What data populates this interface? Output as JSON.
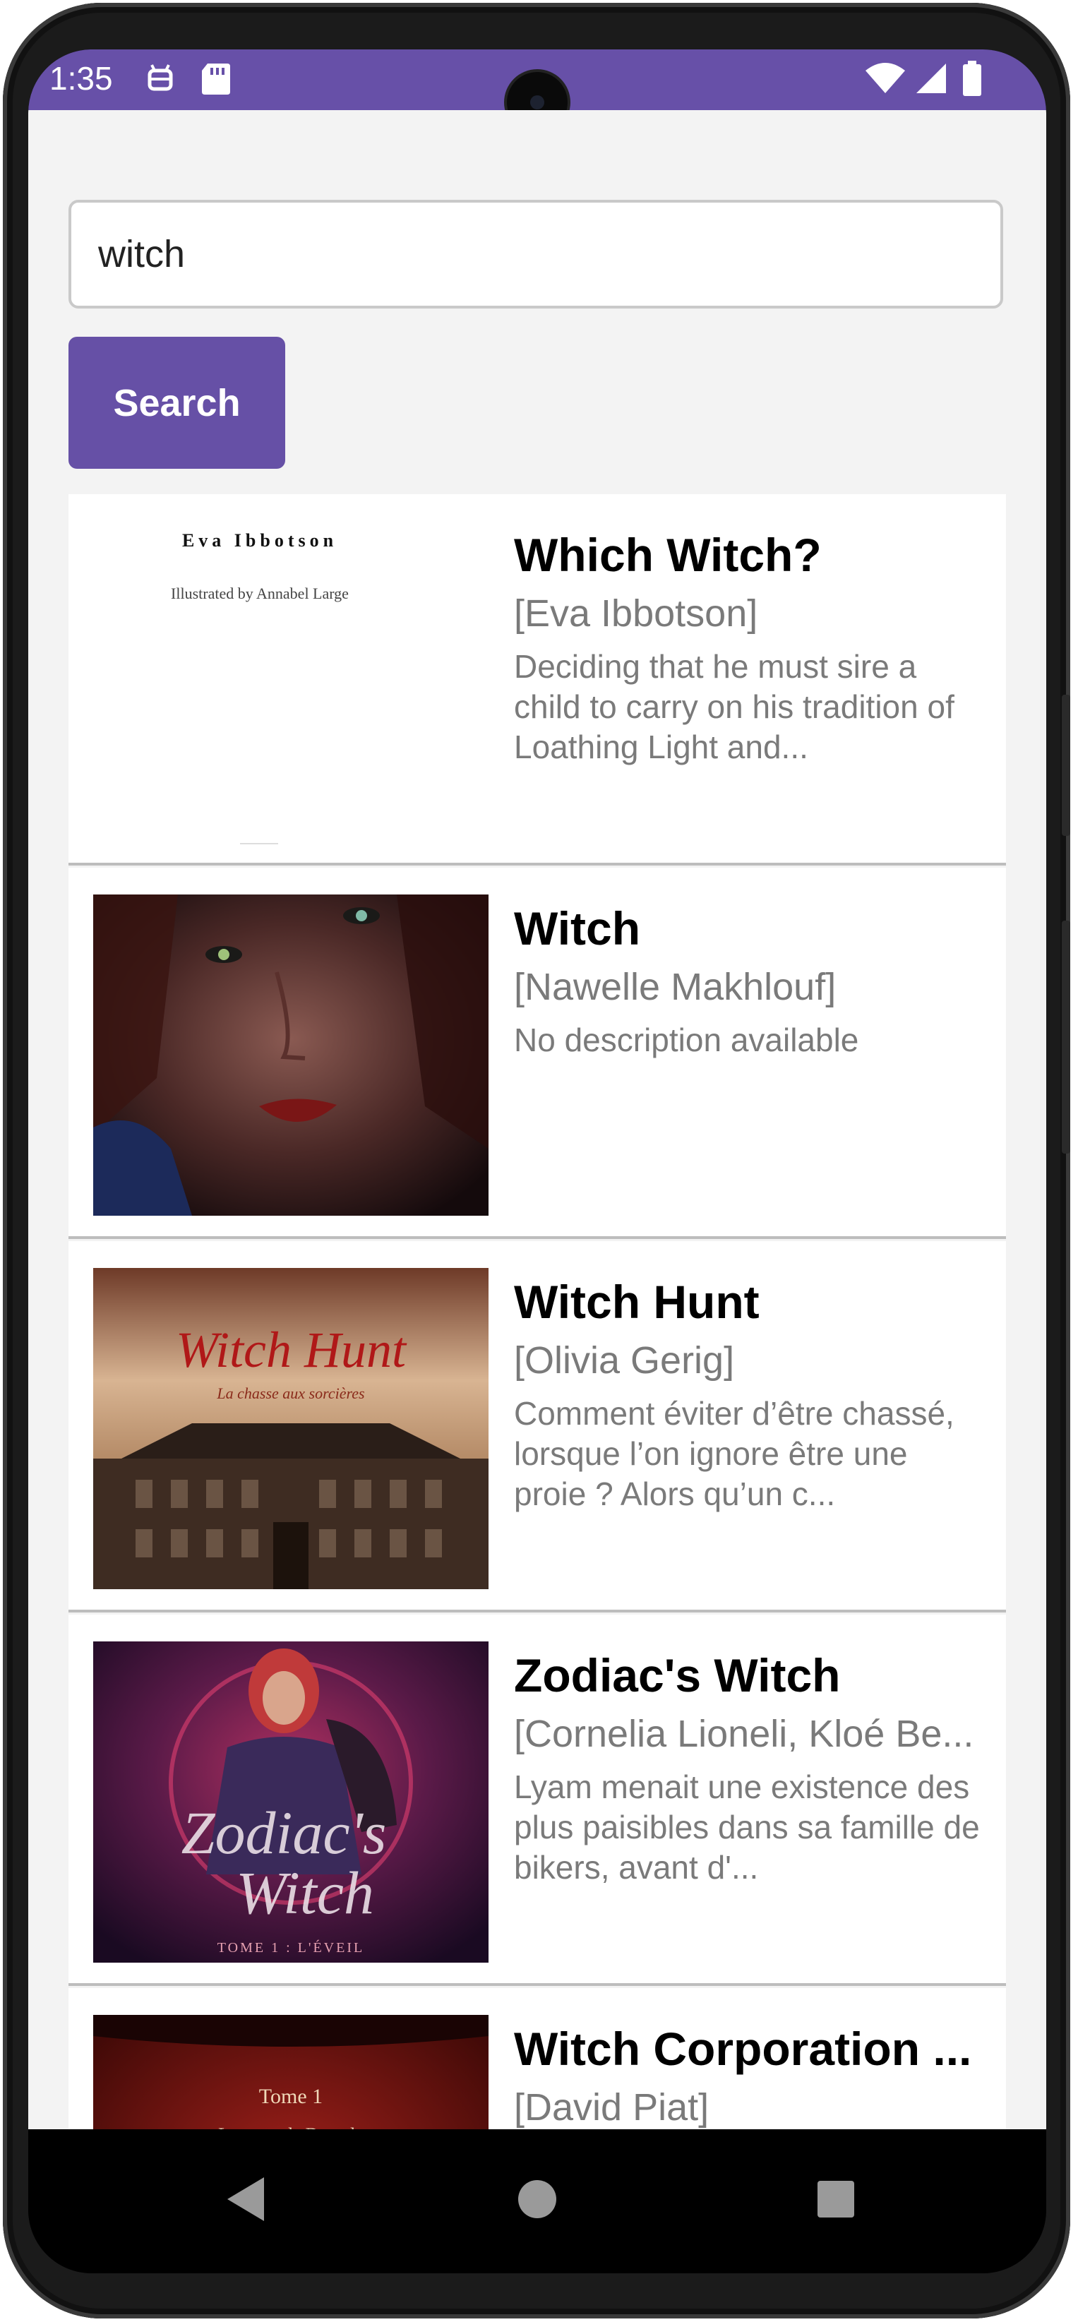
{
  "status_bar": {
    "time": "1:35",
    "left_icons": [
      "android-debug-icon",
      "sd-card-icon"
    ],
    "right_icons": [
      "wifi-icon",
      "cellular-signal-icon",
      "battery-icon"
    ],
    "color": "#6750a8"
  },
  "search": {
    "value": "witch",
    "button_label": "Search"
  },
  "results": [
    {
      "title": "Which Witch?",
      "authors": "[Eva Ibbotson]",
      "description": "Deciding that he must sire a child to carry on his tradition of Loathing Light and...",
      "cover_text": [
        "Eva Ibbotson",
        "Illustrated by Annabel Large"
      ]
    },
    {
      "title": "Witch",
      "authors": "[Nawelle Makhlouf]",
      "description": "No description available"
    },
    {
      "title": "Witch Hunt",
      "authors": "[Olivia Gerig]",
      "description": "Comment éviter d’être chassé, lorsque l’on ignore être une proie ? Alors qu’un c...",
      "cover_text": [
        "Witch Hunt",
        "La chasse aux sorcières"
      ]
    },
    {
      "title": "Zodiac's Witch",
      "authors": "[Cornelia Lioneli, Kloé Be...",
      "description": "Lyam menait une existence des plus paisibles dans sa famille de bikers, avant d'...",
      "cover_text": [
        "Zodiac's",
        "Witch",
        "TOME 1 : L'ÉVEIL"
      ]
    },
    {
      "title": "Witch Corporation ...",
      "authors": "[David Piat]",
      "description": "",
      "cover_text": [
        "Tome 1",
        "La secte de Dracula"
      ]
    }
  ],
  "nav": {
    "back_icon": "back-triangle-icon",
    "home_icon": "home-circle-icon",
    "recents_icon": "recents-square-icon"
  },
  "colors": {
    "accent": "#6650a6",
    "divider": "#bdbdbd",
    "background": "#f3f3f3"
  }
}
